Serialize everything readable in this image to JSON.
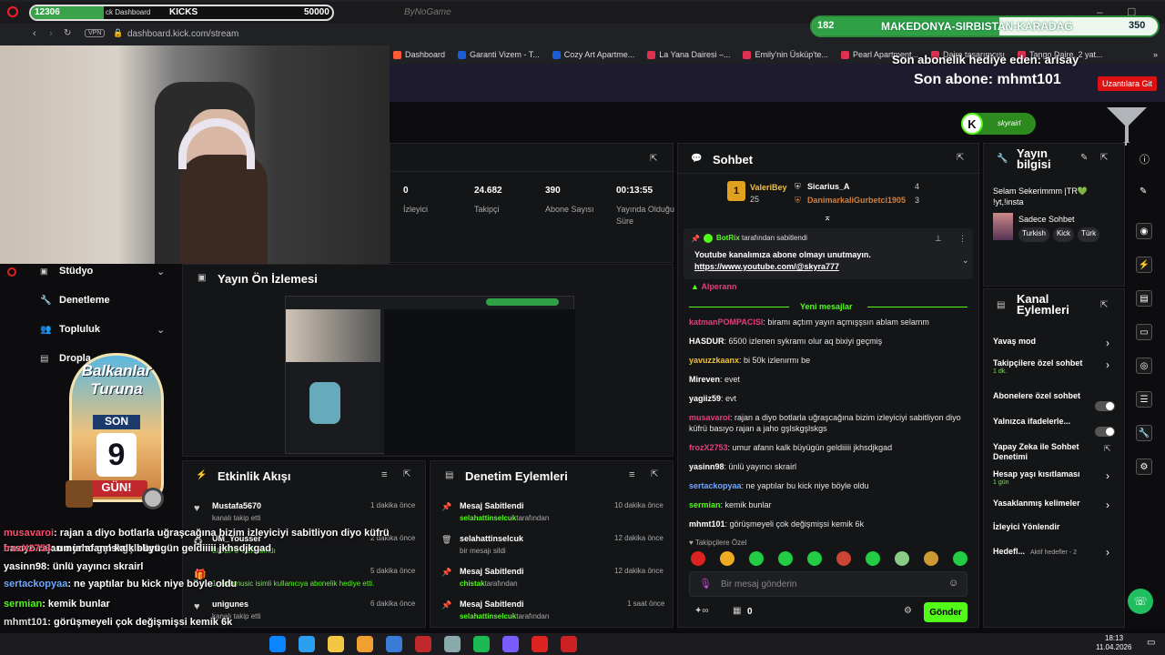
{
  "overlay_top": {
    "left_count": "12306",
    "bar_text": "ck Dashboard",
    "goal_name": "KICKS",
    "goal_target": "50000",
    "brand": "ByNoGame"
  },
  "overlay_right": {
    "count": "182",
    "title": "MAKEDONYA-SIRBISTAN-KARADAG",
    "target": "350"
  },
  "browser": {
    "url": "dashboard.kick.com/stream",
    "vpn": "VPN",
    "bookmarks": [
      "Dashboard",
      "Garanti Vizem - T...",
      "Cozy Art Apartme...",
      "La Yana Dairesi –...",
      "Emily'nin Üsküp'te...",
      "Pearl Apartment...",
      "Daire tasarımcısı",
      "Tango Daire, 2 yat..."
    ]
  },
  "subs": {
    "gift_line": "Son abonelik hediye eden: arisay",
    "last_sub": "Son abone: mhmt101",
    "button": "Uzantılara Git"
  },
  "skyra_badge": "skyrairl",
  "stats": [
    {
      "value": "0",
      "label": "İzleyici"
    },
    {
      "value": "24.682",
      "label": "Takipçi"
    },
    {
      "value": "390",
      "label": "Abone Sayısı"
    },
    {
      "value": "00:13:55",
      "label": "Yayında Olduğu Süre"
    }
  ],
  "nav": [
    {
      "label": "Stüdyo"
    },
    {
      "label": "Denetleme"
    },
    {
      "label": "Topluluk"
    },
    {
      "label": "Dropla"
    }
  ],
  "preview": {
    "title": "Yayın Ön İzlemesi"
  },
  "promo": {
    "line1": "Balkanlar",
    "line2": "Turuna",
    "son": "SON",
    "days": "9",
    "gun": "GÜN!"
  },
  "activity": {
    "title": "Etkinlik Akışı",
    "items": [
      {
        "name": "Mustafa5670",
        "desc": "kanalı takip etti",
        "time": "1 dakika önce"
      },
      {
        "name": "UM_Yousser",
        "desc": "BICEPS VER alındı",
        "time": "2 dakika önce"
      },
      {
        "name": "",
        "desc": "1. rzahmusic isimli kullanıcıya abonelik hediye etti.",
        "time": "5 dakika önce"
      },
      {
        "name": "unigunes",
        "desc": "kanalı takip etti",
        "time": "6 dakika önce"
      }
    ]
  },
  "moderation": {
    "title": "Denetim Eylemleri",
    "items": [
      {
        "action": "Mesaj Sabitlendi",
        "actor": "selahattinselcuk",
        "suffix": "tarafından",
        "time": "10 dakika önce"
      },
      {
        "action": "selahattinselcuk",
        "actor": "",
        "suffix": "bir mesajı sildi",
        "time": "12 dakika önce"
      },
      {
        "action": "Mesaj Sabitlendi",
        "actor": "chistak",
        "suffix": "tarafından",
        "time": "12 dakika önce"
      },
      {
        "action": "Mesaj Sabitlendi",
        "actor": "selahattinselcuk",
        "suffix": "tarafından",
        "time": "1 saat önce"
      }
    ]
  },
  "chat": {
    "title": "Sohbet",
    "leaders": [
      {
        "rank": "1",
        "name": "ValeriBey",
        "count": "25"
      },
      {
        "name": "Sicarius_A",
        "count": "4"
      },
      {
        "name": "DanimarkaliGurbetci1905",
        "count": "3"
      }
    ],
    "pinned": {
      "by": "BotRix",
      "by_suffix": "tarafından sabitlendi",
      "text": "Youtube kanalımıza abone olmayı unutmayın.",
      "link": "https://www.youtube.com/@skyra777"
    },
    "prev_name": "Alperann",
    "new_messages": "Yeni mesajlar",
    "messages": [
      {
        "user": "katmanPOMPACISI",
        "color": "#e0407a",
        "text": ": biramı açtım yayın açmışşsın ablam selamm"
      },
      {
        "user": "HASDUR",
        "color": "#ffffff",
        "text": ": 6500 izlenen sykramı olur aq bixiyi geçmiş"
      },
      {
        "user": "yavuzzkaanx",
        "color": "#f0c040",
        "text": ": bi 50k izlenırmı be"
      },
      {
        "user": "Mireven",
        "color": "#ffffff",
        "text": ": evet"
      },
      {
        "user": "yagiiz59",
        "color": "#ffffff",
        "text": ": evt"
      },
      {
        "user": "musavaroi",
        "color": "#e0407a",
        "text": ": rajan a diyo botlarla uğraşcağına bizim izleyiciyi sabitliyon diyo küfrü basıyo rajan a jaho gşlskgşlskgs"
      },
      {
        "user": "frozX2753",
        "color": "#e0407a",
        "text": ": umur afann kalk büyügün geldiiiii jkhsdjkgad"
      },
      {
        "user": "yasinn98",
        "color": "#ffffff",
        "text": ": ünlü yayıncı skrairl"
      },
      {
        "user": "sertackopyaa",
        "color": "#6fa8ff",
        "text": ": ne yaptılar bu kick niye böyle oldu"
      },
      {
        "user": "sermian",
        "color": "#53fc18",
        "text": ": kemik bunlar"
      },
      {
        "user": "mhmt101",
        "color": "#ffffff",
        "text": ": görüşmeyeli çok değişmişsi kemik 6k"
      }
    ],
    "followers_only": "Takipçilere Özel",
    "placeholder": "Bir mesaj gönderin",
    "points": "0",
    "send": "Gönder"
  },
  "stream_info": {
    "title": "Yayın bilgisi",
    "stream_title": "Selam Sekerimmm |TR💚 !yt,!insta",
    "category": "Sadece Sohbet",
    "tags": [
      "Turkish",
      "Kick",
      "Türk"
    ]
  },
  "channel_actions": {
    "title": "Kanal Eylemleri",
    "items": [
      {
        "label": "Yavaş mod",
        "sub": "",
        "type": "chevron"
      },
      {
        "label": "Takipçilere özel sohbet",
        "sub": "1 dk.",
        "type": "chevron"
      },
      {
        "label": "Abonelere özel sohbet",
        "sub": "",
        "type": "toggle"
      },
      {
        "label": "Yalnızca ifadelerle...",
        "sub": "",
        "type": "toggle"
      },
      {
        "label": "Yapay Zeka ile Sohbet Denetimi",
        "sub": "",
        "type": "external"
      },
      {
        "label": "Hesap yaşı kısıtlaması",
        "sub": "1 gün",
        "type": "chevron"
      },
      {
        "label": "Yasaklanmış kelimeler",
        "sub": "",
        "type": "chevron"
      },
      {
        "label": "İzleyici Yönlendir",
        "sub": "",
        "type": "none"
      },
      {
        "label": "Hedefl...",
        "sub": "Aktif hedefler - 2",
        "type": "chevron"
      }
    ]
  },
  "overlay_chat": [
    {
      "user": "musavaroi",
      "color": "#ff4d6d",
      "text": ": rajan a diyo botlarla uğraşcağına bizim izleyiciyi sabitliyon diyo küfrü basıyo rajan a jaho gşlskgşlskgs"
    },
    {
      "user": "frozX2753",
      "color": "#ff4d6d",
      "text": ": umur afann kalk büyügün geldiiiii jkhsdjkgad"
    },
    {
      "user": "yasinn98",
      "color": "#ffffff",
      "text": ": ünlü yayıncı skrairl"
    },
    {
      "user": "sertackopyaa",
      "color": "#6fa8ff",
      "text": ": ne yaptılar bu kick niye böyle oldu"
    },
    {
      "user": "sermian",
      "color": "#53fc18",
      "text": ": kemik bunlar"
    },
    {
      "user": "mhmt101",
      "color": "#dddddd",
      "text": ": görüşmeyeli çok değişmişsi kemik 6k"
    }
  ],
  "taskbar": {
    "time": "18:13",
    "date": "11.04.2026"
  }
}
